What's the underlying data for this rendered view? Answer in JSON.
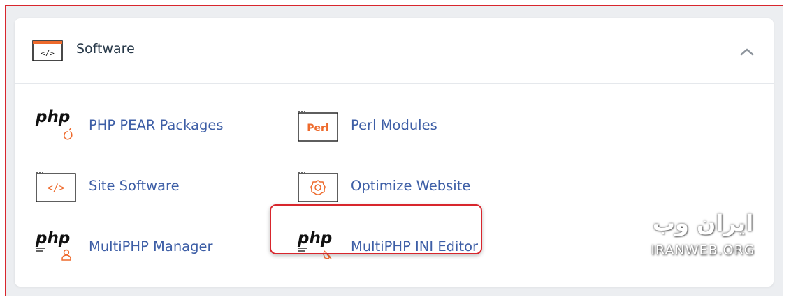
{
  "section": {
    "title": "Software",
    "icon": "code-window-icon"
  },
  "items": [
    {
      "label": "PHP PEAR Packages",
      "icon": "php-pear-icon",
      "badge": "php"
    },
    {
      "label": "Perl Modules",
      "icon": "perl-modules-icon",
      "badge": "Perl"
    },
    {
      "label": "Site Software",
      "icon": "site-software-icon",
      "badge": "</>"
    },
    {
      "label": "Optimize Website",
      "icon": "optimize-gear-icon"
    },
    {
      "label": "MultiPHP Manager",
      "icon": "multiphp-manager-icon",
      "badge": "php"
    },
    {
      "label": "MultiPHP INI Editor",
      "icon": "multiphp-ini-editor-icon",
      "badge": "php"
    }
  ],
  "watermark": {
    "persian": "ایران وب",
    "latin": "IRANWEB.ORG"
  },
  "colors": {
    "accent_orange": "#ee6a2c",
    "link_blue": "#3d5ea6",
    "highlight_red": "#d8262d"
  }
}
